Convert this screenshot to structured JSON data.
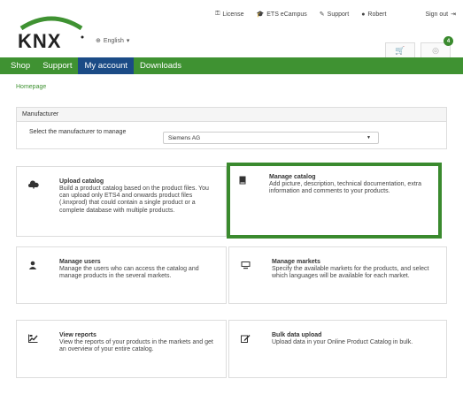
{
  "brand": {
    "logo_text": "KNX",
    "accent": "#3f9232",
    "active_tab_color": "#1b4b86"
  },
  "language": {
    "label": "English",
    "icon": "globe-icon"
  },
  "toplinks": [
    {
      "label": "License",
      "icon": "key-icon"
    },
    {
      "label": "ETS eCampus",
      "icon": "graduation-cap-icon"
    },
    {
      "label": "Support",
      "icon": "wrench-icon"
    },
    {
      "label": "Robert",
      "icon": "user-icon"
    }
  ],
  "signout": {
    "label": "Sign out",
    "icon": "sign-out-icon"
  },
  "notifications": {
    "count": "4"
  },
  "nav": {
    "tabs": [
      "Shop",
      "Support",
      "My account",
      "Downloads"
    ],
    "active": "My account"
  },
  "breadcrumb": "Homepage",
  "manufacturer": {
    "heading": "Manufacturer",
    "label": "Select the manufacturer to manage",
    "selected": "Siemens AG"
  },
  "cards": [
    {
      "title": "Upload catalog",
      "description": "Build a product catalog based on the product files. You can upload only ETS4 and onwards product files (.knxprod) that could contain a single product or a complete database with multiple products.",
      "icon": "cloud-upload-icon"
    },
    {
      "title": "Manage catalog",
      "description": "Add picture, description, technical documentation, extra information and comments to your products.",
      "icon": "book-icon"
    },
    {
      "title": "Manage users",
      "description": "Manage the users who can access the catalog and manage products in the several markets.",
      "icon": "user-icon"
    },
    {
      "title": "Manage markets",
      "description": "Specify the available markets for the products, and select which languages will be available for each market.",
      "icon": "monitor-icon"
    },
    {
      "title": "View reports",
      "description": "View the reports of your products in the markets and get an overview of your entire catalog.",
      "icon": "chart-icon"
    },
    {
      "title": "Bulk data upload",
      "description": "Upload data in your Online Product Catalog in bulk.",
      "icon": "edit-icon"
    }
  ]
}
